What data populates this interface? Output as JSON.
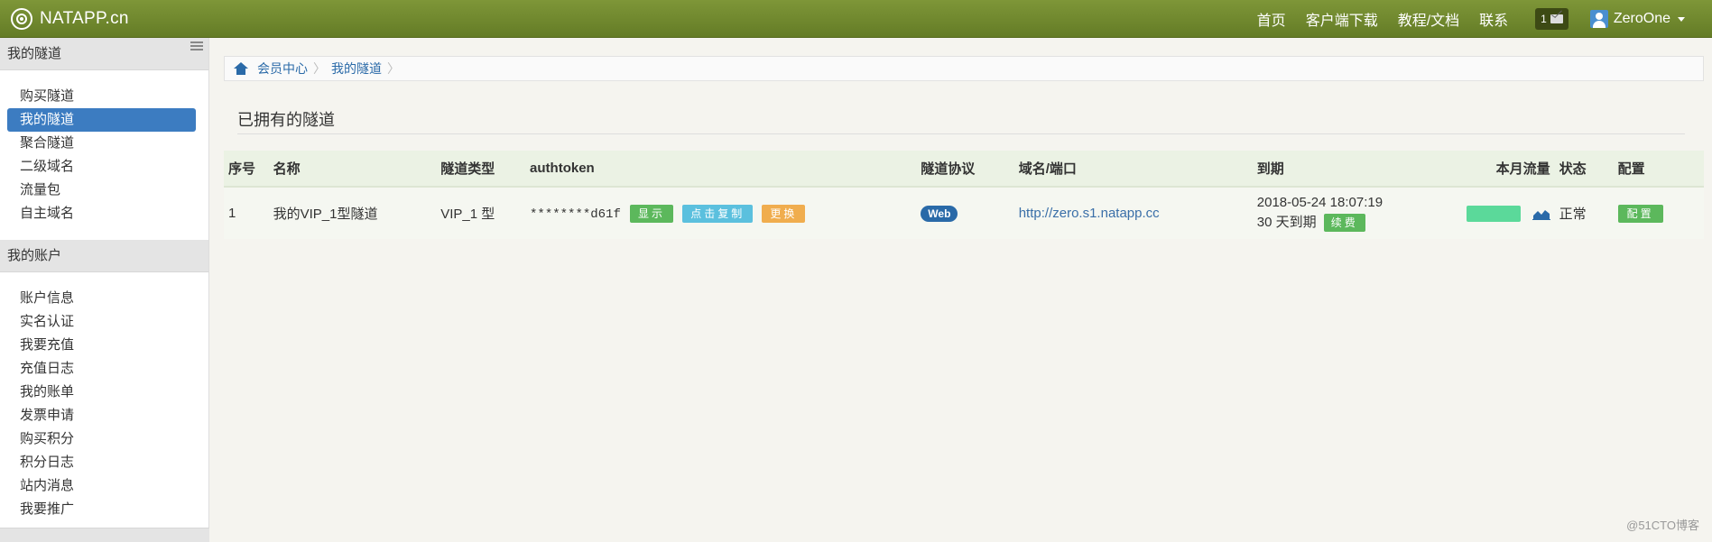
{
  "navbar": {
    "brand": "NATAPP.cn",
    "links": [
      "首页",
      "客户端下载",
      "教程/文档",
      "联系"
    ],
    "message_count": "1",
    "username": "ZeroOne"
  },
  "sidebar": {
    "sections": [
      {
        "title": "我的隧道",
        "items": [
          "购买隧道",
          "我的隧道",
          "聚合隧道",
          "二级域名",
          "流量包",
          "自主域名"
        ]
      },
      {
        "title": "我的账户",
        "items": [
          "账户信息",
          "实名认证",
          "我要充值",
          "充值日志",
          "我的账单",
          "发票申请",
          "购买积分",
          "积分日志",
          "站内消息",
          "我要推广"
        ]
      }
    ],
    "active_item": "我的隧道"
  },
  "breadcrumb": [
    "会员中心",
    "我的隧道"
  ],
  "page_title": "已拥有的隧道",
  "table": {
    "headers": [
      "序号",
      "名称",
      "隧道类型",
      "authtoken",
      "隧道协议",
      "域名/端口",
      "到期",
      "本月流量",
      "状态",
      "配置"
    ],
    "rows": [
      {
        "index": "1",
        "name": "我的VIP_1型隧道",
        "type": "VIP_1 型",
        "authtoken": "********d61f",
        "show_label": "显示",
        "copy_label": "点击复制",
        "change_label": "更换",
        "protocol": "Web",
        "domain": "http://zero.s1.natapp.cc",
        "expire_date": "2018-05-24 18:07:19",
        "expire_days": "30 天到期",
        "renew_label": "续费",
        "status": "正常",
        "config_label": "配置"
      }
    ]
  },
  "watermark": "@51CTO博客",
  "colors": {
    "navbar": "#718a2f",
    "active_sidebar": "#3c7cc1",
    "success": "#5cb85c",
    "info": "#5bc0de",
    "warning": "#f0ad4e",
    "traffic": "#5bd99a"
  }
}
